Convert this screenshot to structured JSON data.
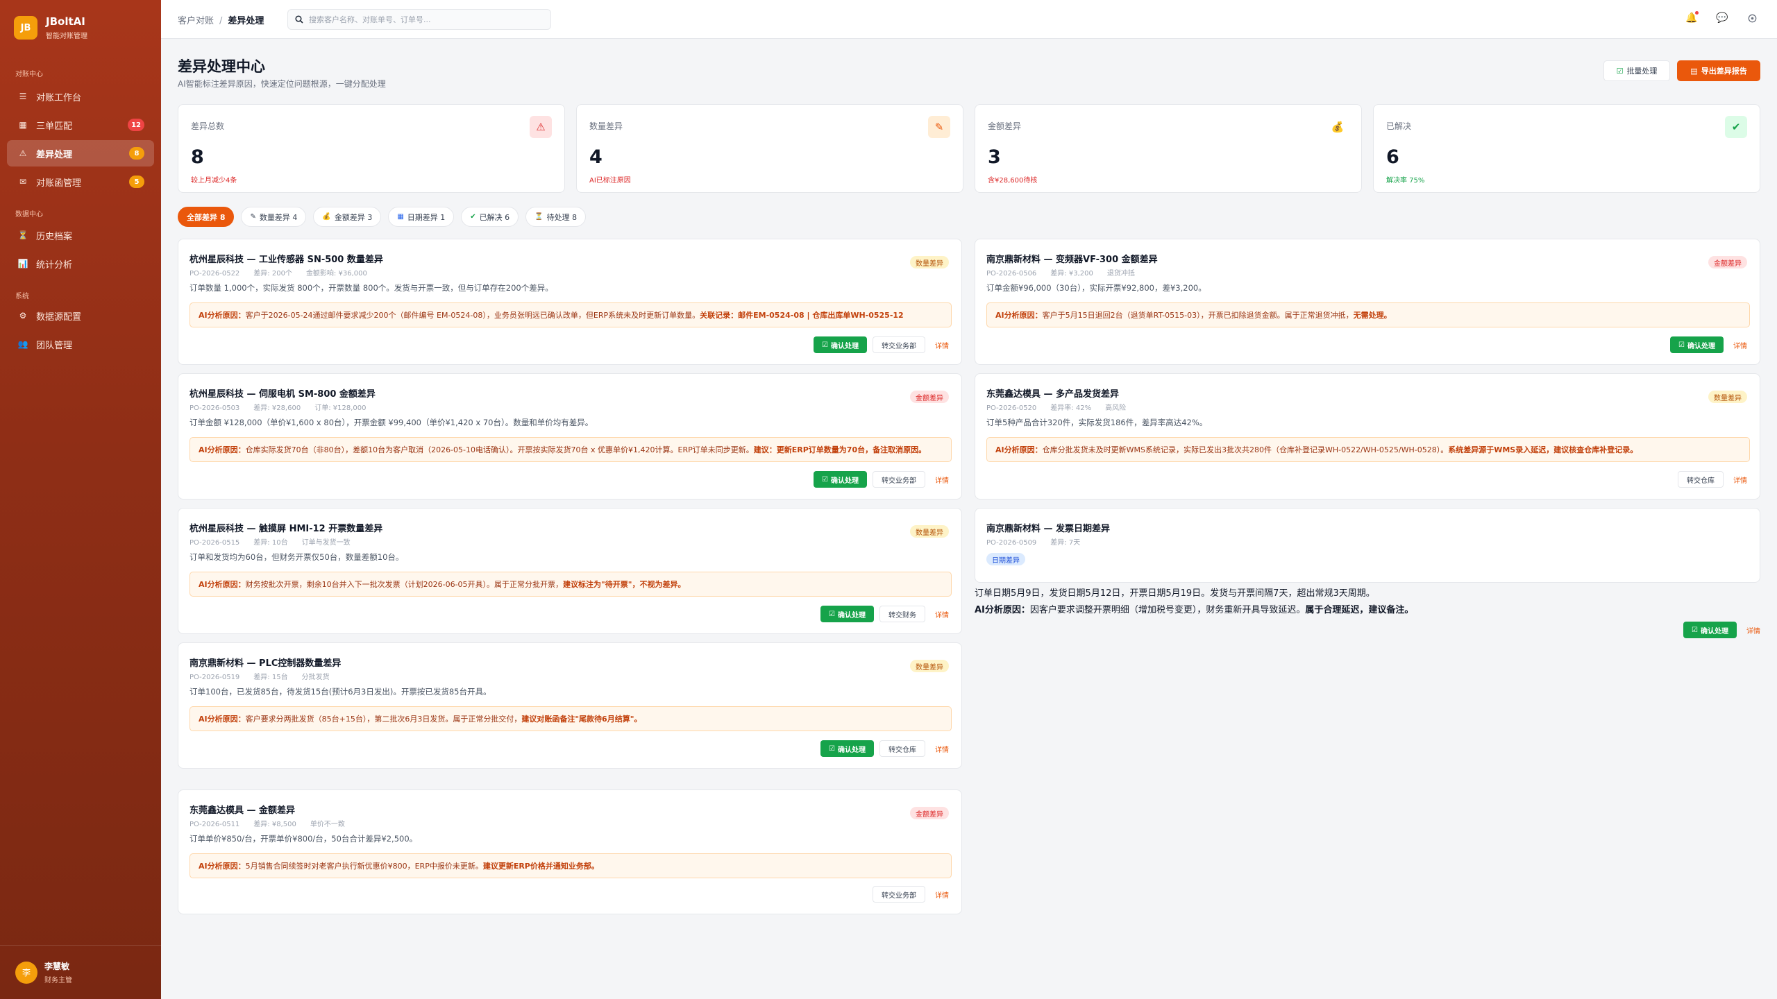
{
  "app": {
    "logo_badge": "JB",
    "name": "JBoltAI",
    "subtitle": "智能对账管理"
  },
  "sidebar": {
    "sections": [
      "对账中心",
      "数据中心",
      "系统"
    ],
    "items": [
      {
        "label": "对账工作台",
        "icon": "☰"
      },
      {
        "label": "三单匹配",
        "icon": "▦",
        "badge": "12"
      },
      {
        "label": "差异处理",
        "icon": "⚠",
        "badge": "8"
      },
      {
        "label": "对账函管理",
        "icon": "✉",
        "badge": "5"
      },
      {
        "label": "历史档案",
        "icon": "⏳"
      },
      {
        "label": "统计分析",
        "icon": "📊"
      },
      {
        "label": "数据源配置",
        "icon": "⚙"
      },
      {
        "label": "团队管理",
        "icon": "👥"
      }
    ],
    "user": {
      "avatar": "李",
      "name": "李慧敏",
      "role": "财务主管"
    }
  },
  "topbar": {
    "breadcrumb_root": "客户对账",
    "breadcrumb_sep": "/",
    "breadcrumb_current": "差异处理",
    "search_placeholder": "搜索客户名称、对账单号、订单号..."
  },
  "page": {
    "title": "差异处理中心",
    "subtitle": "AI智能标注差异原因，快速定位问题根源，一键分配处理",
    "batch_label": "批量处理",
    "export_label": "导出差异报告"
  },
  "stats": [
    {
      "label": "差异总数",
      "value": "8",
      "note": "较上月减少4条",
      "icon": "⚠"
    },
    {
      "label": "数量差异",
      "value": "4",
      "note": "AI已标注原因",
      "icon": "✎"
    },
    {
      "label": "金额差异",
      "value": "3",
      "note": "含¥28,600待核",
      "icon": "💰"
    },
    {
      "label": "已解决",
      "value": "6",
      "note": "解决率 75%",
      "icon": "✔"
    }
  ],
  "filters": [
    {
      "label": "全部差异 8",
      "icon": ""
    },
    {
      "label": "数量差异 4",
      "icon": "✎"
    },
    {
      "label": "金额差异 3",
      "icon": "💰"
    },
    {
      "label": "日期差异 1",
      "icon": "▦"
    },
    {
      "label": "已解决 6",
      "icon": "✔"
    },
    {
      "label": "待处理 8",
      "icon": "⏳"
    }
  ],
  "ai_label": "AI分析原因：",
  "actions": {
    "confirm": "确认处理",
    "detail": "详情"
  },
  "cards": [
    {
      "title": "杭州星辰科技 — 工业传感器 SN-500 数量差异",
      "meta": [
        "PO-2026-0522",
        "差异: 200个",
        "金额影响: ¥36,000"
      ],
      "desc": "订单数量 1,000个，实际发货 800个，开票数量 800个。发货与开票一致，但与订单存在200个差异。",
      "ai_text": "客户于2026-05-24通过邮件要求减少200个（邮件编号 EM-0524-08），业务员张明远已确认改单，但ERP系统未及时更新订单数量。",
      "ai_strong": "关联记录：邮件EM-0524-08 | 仓库出库单WH-0525-12",
      "tag": "数量差异",
      "forward": "转交业务部"
    },
    {
      "title": "南京鼎新材料 — 变频器VF-300 金额差异",
      "meta": [
        "PO-2026-0506",
        "差异: ¥3,200",
        "退货冲抵"
      ],
      "desc": "订单金额¥96,000（30台），实际开票¥92,800，差¥3,200。",
      "ai_text": "客户于5月15日退回2台（退货单RT-0515-03），开票已扣除退货金额。属于正常退货冲抵，",
      "ai_strong": "无需处理。",
      "tag": "金额差异"
    },
    {
      "title": "杭州星辰科技 — 伺服电机 SM-800 金额差异",
      "meta": [
        "PO-2026-0503",
        "差异: ¥28,600",
        "订单: ¥128,000"
      ],
      "desc": "订单金额 ¥128,000（单价¥1,600 x 80台），开票金额 ¥99,400（单价¥1,420 x 70台）。数量和单价均有差异。",
      "ai_text": "仓库实际发货70台（非80台），差额10台为客户取消（2026-05-10电话确认）。开票按实际发货70台 x 优惠单价¥1,420计算。ERP订单未同步更新。",
      "ai_strong": "建议：更新ERP订单数量为70台，备注取消原因。",
      "tag": "金额差异",
      "forward": "转交业务部"
    },
    {
      "title": "东莞鑫达模具 — 多产品发货差异",
      "meta": [
        "PO-2026-0520",
        "差异率: 42%",
        "高风险"
      ],
      "desc": "订单5种产品合计320件，实际发货186件，差异率高达42%。",
      "ai_text": "仓库分批发货未及时更新WMS系统记录，实际已发出3批次共280件（仓库补登记录WH-0522/WH-0525/WH-0528）。",
      "ai_strong": "系统差异源于WMS录入延迟，建议核查仓库补登记录。",
      "tag": "数量差异",
      "forward": "转交仓库"
    },
    {
      "title": "杭州星辰科技 — 触摸屏 HMI-12 开票数量差异",
      "meta": [
        "PO-2026-0515",
        "差异: 10台",
        "订单与发货一致"
      ],
      "desc": "订单和发货均为60台，但财务开票仅50台，数量差额10台。",
      "ai_text": "财务按批次开票，剩余10台并入下一批次发票（计划2026-06-05开具）。属于正常分批开票，",
      "ai_strong": "建议标注为\"待开票\"，不视为差异。",
      "tag": "数量差异",
      "forward": "转交财务"
    },
    {
      "title": "南京鼎新材料 — 发票日期差异",
      "meta": [
        "PO-2026-0509",
        "差异: 7天"
      ],
      "desc": "订单日期5月9日，发货日期5月12日，开票日期5月19日。发货与开票间隔7天，超出常规3天周期。",
      "ai_text": "因客户要求调整开票明细（增加税号变更），财务重新开具导致延迟。",
      "ai_strong": "属于合理延迟，建议备注。",
      "tag": "日期差异"
    },
    {
      "title": "南京鼎新材料 — PLC控制器数量差异",
      "meta": [
        "PO-2026-0519",
        "差异: 15台",
        "分批发货"
      ],
      "desc": "订单100台，已发货85台，待发货15台(预计6月3日发出)。开票按已发货85台开具。",
      "ai_text": "客户要求分两批发货（85台+15台），第二批次6月3日发货。属于正常分批交付，",
      "ai_strong": "建议对账函备注\"尾款待6月结算\"。",
      "tag": "数量差异",
      "forward": "转交仓库"
    },
    {
      "title": "东莞鑫达模具 — 金额差异",
      "meta": [
        "PO-2026-0511",
        "差异: ¥8,500",
        "单价不一致"
      ],
      "desc": "订单单价¥850/台，开票单价¥800/台，50台合计差异¥2,500。",
      "ai_text": "5月销售合同续签时对老客户执行新优惠价¥800，ERP中报价未更新。",
      "ai_strong": "建议更新ERP价格并通知业务部。",
      "tag": "金额差异",
      "forward": "转交业务部"
    }
  ]
}
